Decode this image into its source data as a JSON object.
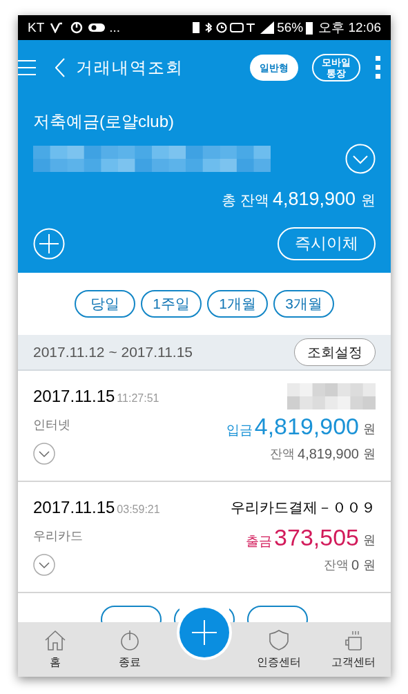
{
  "status_bar": {
    "carrier": "KT",
    "more": "...",
    "battery": "56%",
    "time": "오후 12:06"
  },
  "header": {
    "title": "거래내역조회",
    "buttons": [
      {
        "label": "일반형",
        "selected": true
      },
      {
        "label": "모바일\n통장",
        "selected": false
      }
    ]
  },
  "account": {
    "name": "저축예금(로얄club)",
    "balance_label": "총 잔액",
    "balance": "4,819,900",
    "unit": "원",
    "transfer_button": "즉시이체"
  },
  "periods": [
    {
      "label": "당일"
    },
    {
      "label": "1주일"
    },
    {
      "label": "1개월"
    },
    {
      "label": "3개월"
    }
  ],
  "date_range": {
    "text": "2017.11.12 ~ 2017.11.15",
    "button": "조회설정"
  },
  "transactions": [
    {
      "date": "2017.11.15",
      "time": "11:27:51",
      "memo_hidden": true,
      "channel": "인터넷",
      "kind": "deposit",
      "type_label": "입금",
      "amount": "4,819,900",
      "unit": "원",
      "balance_label": "잔액",
      "balance": "4,819,900",
      "balance_unit": "원"
    },
    {
      "date": "2017.11.15",
      "time": "03:59:21",
      "memo_hidden": false,
      "memo": "우리카드결제－００９",
      "channel": "우리카드",
      "kind": "withdrawal",
      "type_label": "출금",
      "amount": "373,505",
      "unit": "원",
      "balance_label": "잔액",
      "balance": "0",
      "balance_unit": "원"
    }
  ],
  "bottom_nav": [
    {
      "label": "홈"
    },
    {
      "label": "종료"
    },
    {
      "label": "인증센터"
    },
    {
      "label": "고객센터"
    }
  ]
}
